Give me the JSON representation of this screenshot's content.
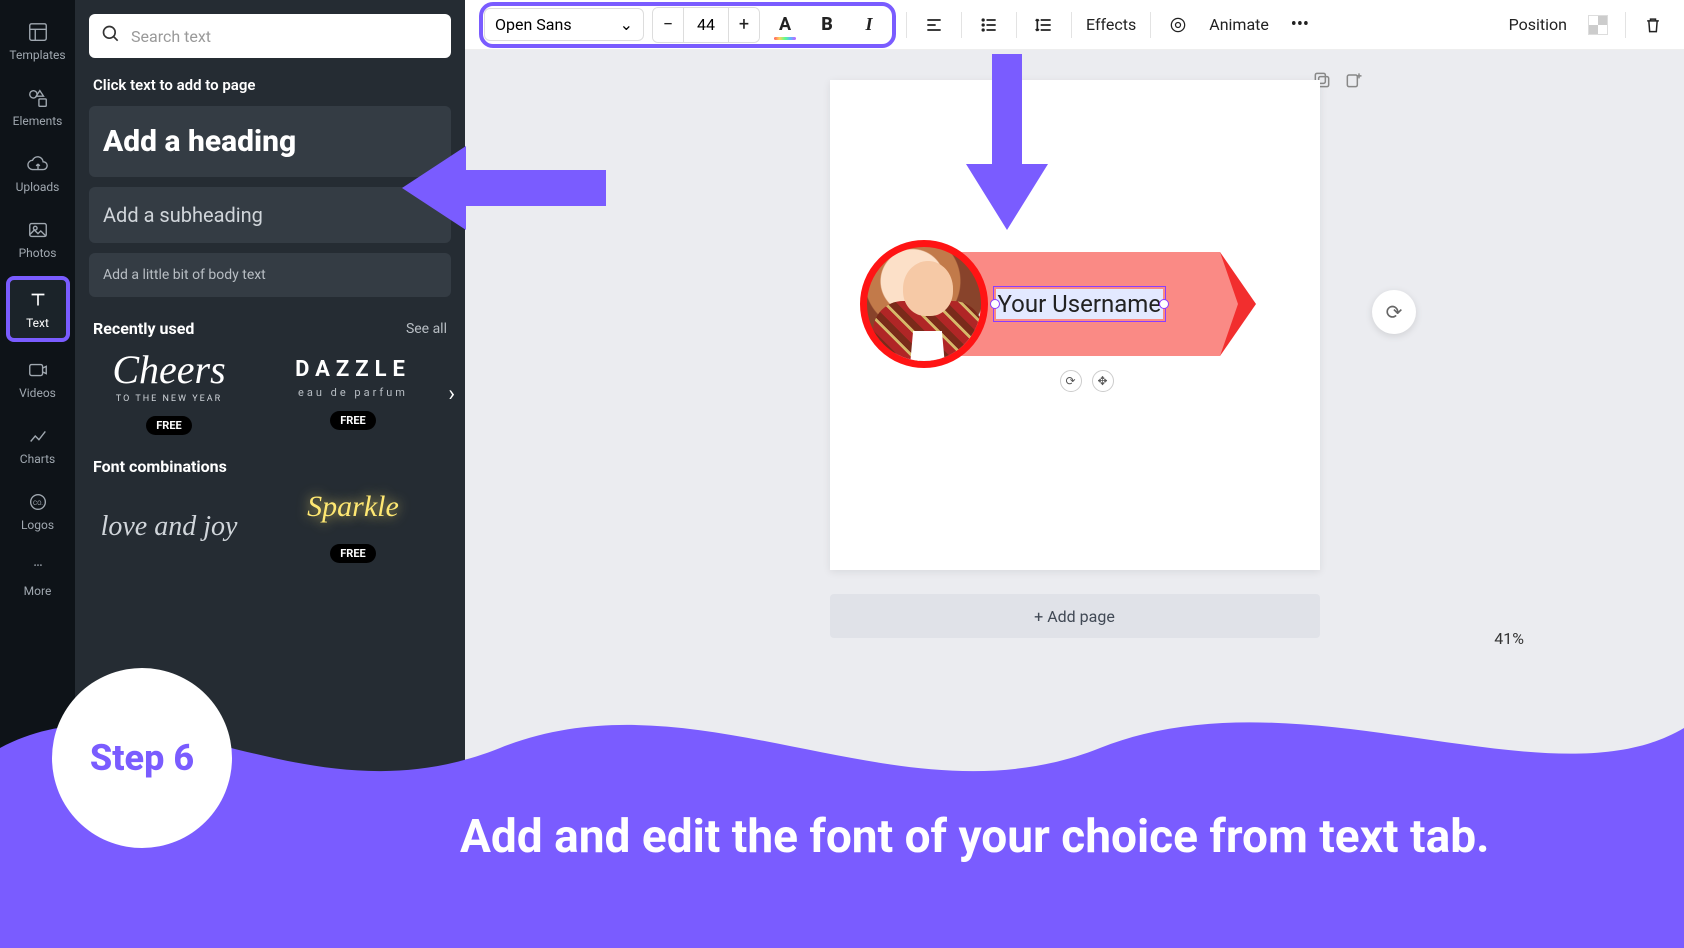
{
  "rail": {
    "templates": "Templates",
    "elements": "Elements",
    "uploads": "Uploads",
    "photos": "Photos",
    "text": "Text",
    "videos": "Videos",
    "charts": "Charts",
    "logos": "Logos",
    "more": "More"
  },
  "panel": {
    "search_placeholder": "Search text",
    "hint": "Click text to add to page",
    "heading_btn": "Add a heading",
    "subheading_btn": "Add a subheading",
    "body_btn": "Add a little bit of body text",
    "recently_used": "Recently used",
    "see_all": "See all",
    "font_combinations": "Font combinations",
    "free_badge": "FREE",
    "cheers": "Cheers",
    "cheers_sub": "TO THE NEW YEAR",
    "dazzle": "DAZZLE",
    "dazzle_sub": "eau de parfum",
    "love": "love and joy",
    "sparkle": "Sparkle"
  },
  "toolbar": {
    "font_name": "Open Sans",
    "font_size": "44",
    "effects": "Effects",
    "animate": "Animate",
    "position": "Position"
  },
  "canvas": {
    "banner_text": "Your Username",
    "add_page": "+ Add page",
    "zoom": "41%"
  },
  "overlay": {
    "step": "Step 6",
    "caption": "Add and edit the font of your choice from text tab."
  },
  "colors": {
    "accent": "#7a5cff"
  }
}
